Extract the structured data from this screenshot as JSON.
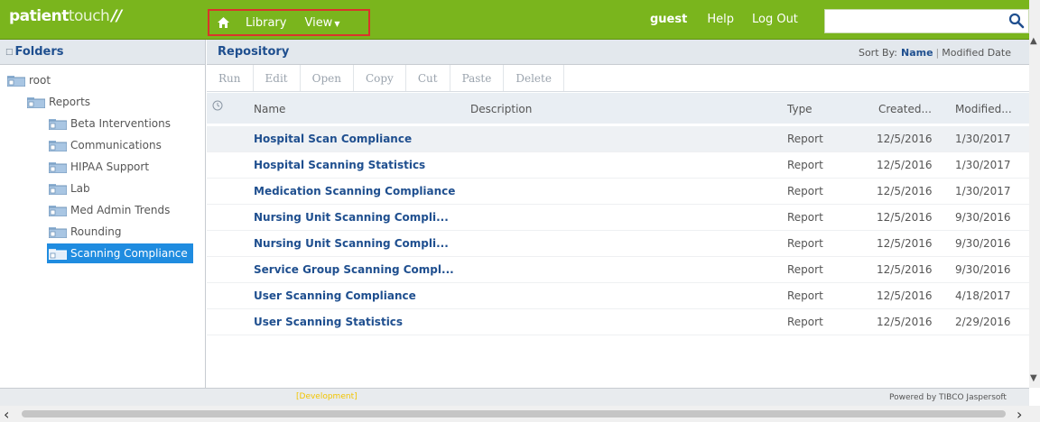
{
  "logo": {
    "bold": "patient",
    "thin": "touch",
    "mark": "//"
  },
  "nav": {
    "library": "Library",
    "view": "View"
  },
  "user": {
    "name": "guest",
    "help": "Help",
    "logout": "Log Out"
  },
  "search": {
    "placeholder": ""
  },
  "folders": {
    "title": "Folders",
    "items": [
      {
        "label": "root"
      },
      {
        "label": "Reports"
      },
      {
        "label": "Beta Interventions"
      },
      {
        "label": "Communications"
      },
      {
        "label": "HIPAA Support"
      },
      {
        "label": "Lab"
      },
      {
        "label": "Med Admin Trends"
      },
      {
        "label": "Rounding"
      },
      {
        "label": "Scanning Compliance"
      }
    ]
  },
  "repository": {
    "title": "Repository",
    "sort_label": "Sort By:",
    "sort_active": "Name",
    "sort_option": "Modified Date",
    "toolbar": [
      "Run",
      "Edit",
      "Open",
      "Copy",
      "Cut",
      "Paste",
      "Delete"
    ],
    "columns": {
      "name": "Name",
      "description": "Description",
      "type": "Type",
      "created": "Created...",
      "modified": "Modified..."
    },
    "rows": [
      {
        "name": "Hospital Scan Compliance",
        "type": "Report",
        "created": "12/5/2016",
        "modified": "1/30/2017"
      },
      {
        "name": "Hospital Scanning Statistics",
        "type": "Report",
        "created": "12/5/2016",
        "modified": "1/30/2017"
      },
      {
        "name": "Medication Scanning Compliance",
        "type": "Report",
        "created": "12/5/2016",
        "modified": "1/30/2017"
      },
      {
        "name": "Nursing Unit Scanning Compli...",
        "type": "Report",
        "created": "12/5/2016",
        "modified": "9/30/2016"
      },
      {
        "name": "Nursing Unit Scanning Compli...",
        "type": "Report",
        "created": "12/5/2016",
        "modified": "9/30/2016"
      },
      {
        "name": "Service Group Scanning Compl...",
        "type": "Report",
        "created": "12/5/2016",
        "modified": "9/30/2016"
      },
      {
        "name": "User Scanning Compliance",
        "type": "Report",
        "created": "12/5/2016",
        "modified": "4/18/2017"
      },
      {
        "name": "User Scanning Statistics",
        "type": "Report",
        "created": "12/5/2016",
        "modified": "2/29/2016"
      }
    ]
  },
  "footer": {
    "dev": "[Development]",
    "powered": "Powered by TIBCO Jaspersoft"
  },
  "colors": {
    "brand_green": "#7ab51d",
    "link_blue": "#1f4f8f",
    "selection_blue": "#1f8ce0",
    "highlight_red": "#d9342b"
  }
}
